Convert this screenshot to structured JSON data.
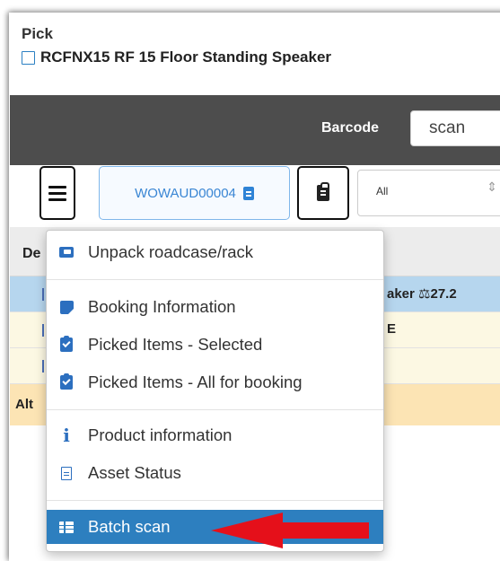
{
  "header": {
    "title": "Pick",
    "item": "RCFNX15 RF 15 Floor Standing Speaker"
  },
  "barcode": {
    "label": "Barcode",
    "value": "scan"
  },
  "toolbar": {
    "booking_ref": "WOWAUD00004",
    "filter_value": "All"
  },
  "table": {
    "header_fragment": "De",
    "rows": [
      {
        "text": "aker  ⚖27.2 ",
        "style": "selected"
      },
      {
        "text": "E",
        "style": "yellow"
      },
      {
        "text": "",
        "style": "yellow"
      }
    ],
    "alt_fragment": "Alt"
  },
  "menu": {
    "items": [
      {
        "label": "Unpack roadcase/rack",
        "icon": "box-open-icon"
      },
      {
        "label": "Booking Information",
        "icon": "folded-note-icon"
      },
      {
        "label": "Picked Items - Selected",
        "icon": "clipboard-check-icon"
      },
      {
        "label": "Picked Items - All for booking",
        "icon": "clipboard-check-icon"
      },
      {
        "label": "Product information",
        "icon": "info-icon"
      },
      {
        "label": "Asset Status",
        "icon": "document-icon"
      },
      {
        "label": "Batch scan",
        "icon": "table-icon",
        "active": true
      }
    ]
  },
  "colors": {
    "accent": "#2d7fbf",
    "dark_bar": "#4d4d4d",
    "selected_row": "#b6d6ee",
    "warning_row": "#fce4b4",
    "annotation_arrow": "#e5101a"
  }
}
